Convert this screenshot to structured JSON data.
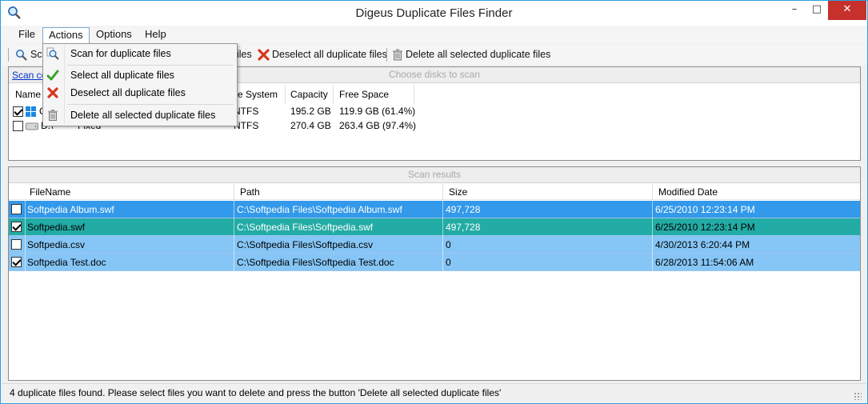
{
  "window": {
    "title": "Digeus Duplicate Files Finder",
    "minimize": "–",
    "maximize": "□",
    "close": "✕"
  },
  "menubar": {
    "items": [
      "File",
      "Actions",
      "Options",
      "Help"
    ],
    "active": "Actions"
  },
  "toolbar": {
    "scan_label_visible": "Sc",
    "select_label_visible": "iles",
    "deselect_label": "Deselect all duplicate files",
    "delete_label": "Delete all selected duplicate files"
  },
  "actions_menu": {
    "items": [
      {
        "label": "Scan for duplicate files",
        "icon": "scan-icon"
      },
      {
        "label": "Select all duplicate files",
        "icon": "check-icon"
      },
      {
        "label": "Deselect all duplicate files",
        "icon": "cross-icon"
      },
      {
        "label": "Delete all selected duplicate files",
        "icon": "trash-icon"
      }
    ]
  },
  "disks": {
    "header": "Choose disks to scan",
    "scan_link_visible": "Scan ce",
    "columns": {
      "name": "Name",
      "filesystem_visible": "e System",
      "capacity": "Capacity",
      "free_space": "Free Space"
    },
    "rows": [
      {
        "checked": true,
        "name_visible": "C",
        "type_visible": "",
        "filesystem_visible": "NTFS",
        "capacity": "195.2 GB",
        "free_space": "119.9 GB (61.4%)"
      },
      {
        "checked": false,
        "name_visible": "D:\\",
        "type_visible": "Fixed",
        "filesystem_visible": "NTFS",
        "capacity": "270.4 GB",
        "free_space": "263.4 GB (97.4%)"
      }
    ]
  },
  "results": {
    "header": "Scan results",
    "columns": [
      "FileName",
      "Path",
      "Size",
      "Modified Date"
    ],
    "rows": [
      {
        "checked": false,
        "filename": "Softpedia Album.swf",
        "path": "C:\\Softpedia Files\\Softpedia Album.swf",
        "size": "497,728",
        "modified": "6/25/2010 12:23:14 PM",
        "color": "#3399ea"
      },
      {
        "checked": true,
        "filename": "Softpedia.swf",
        "path": "C:\\Softpedia Files\\Softpedia.swf",
        "size": "497,728",
        "modified": "6/25/2010 12:23:14 PM",
        "color": "#23aba5"
      },
      {
        "checked": false,
        "filename": "Softpedia.csv",
        "path": "C:\\Softpedia Files\\Softpedia.csv",
        "size": "0",
        "modified": "4/30/2013 6:20:44 PM",
        "color": "#86c6f6"
      },
      {
        "checked": true,
        "filename": "Softpedia Test.doc",
        "path": "C:\\Softpedia Files\\Softpedia Test.doc",
        "size": "0",
        "modified": "6/28/2013 11:54:06 AM",
        "color": "#86c6f6"
      }
    ]
  },
  "status": {
    "text": "4 duplicate files found. Please select files you want to delete and press the button 'Delete all selected duplicate files'"
  },
  "colors": {
    "accent_border": "#29a1e0",
    "close_button": "#c7312c",
    "link": "#0033cc"
  }
}
